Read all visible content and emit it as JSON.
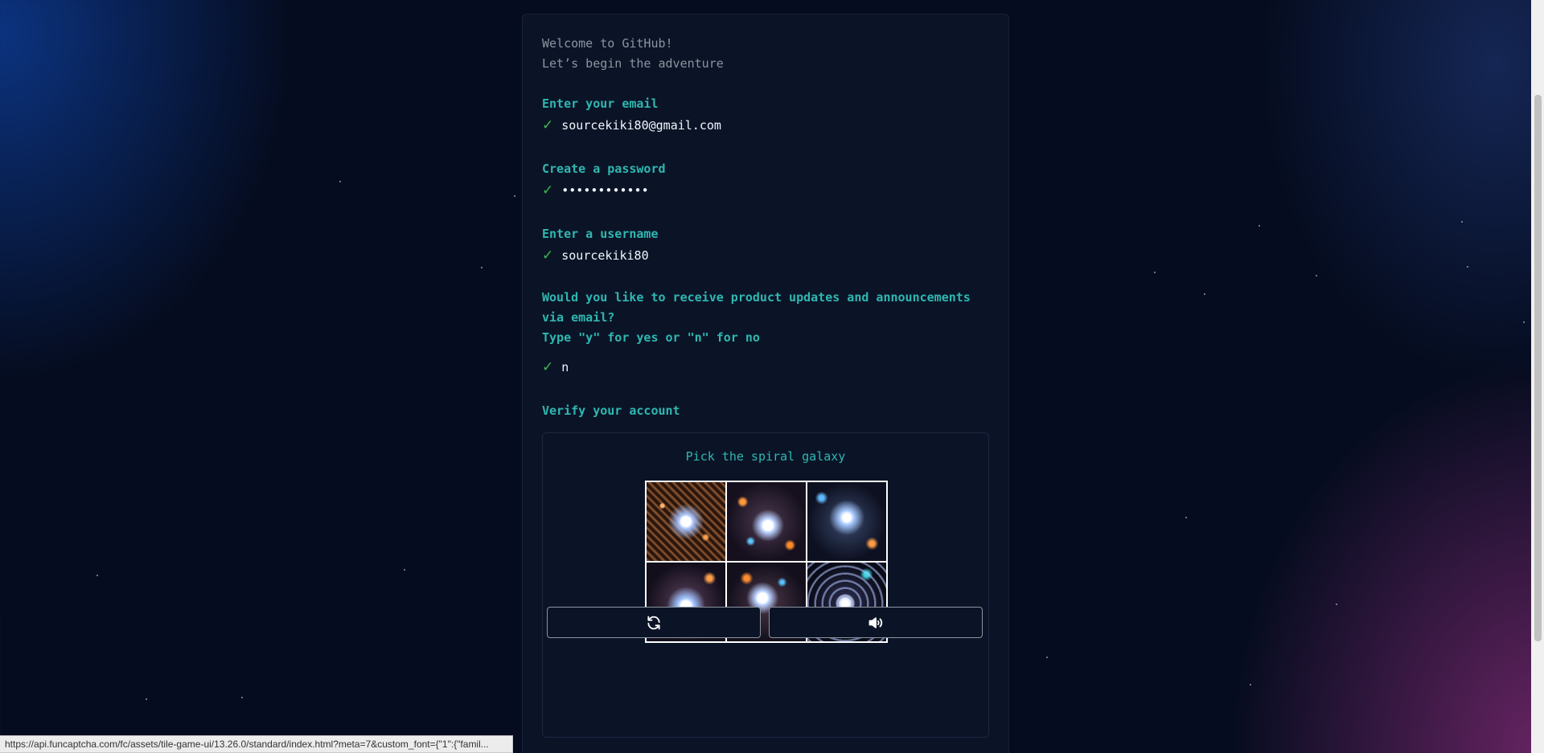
{
  "form": {
    "welcome_line1": "Welcome to GitHub!",
    "welcome_line2": "Let’s begin the adventure",
    "email_label": "Enter your email",
    "email_value": "sourcekiki80@gmail.com",
    "password_label": "Create a password",
    "password_value": "••••••••••••",
    "username_label": "Enter a username",
    "username_value": "sourcekiki80",
    "updates_question": "Would you like to receive product updates and announcements via email?",
    "updates_hint": "Type \"y\" for yes or \"n\" for no",
    "updates_value": "n",
    "verify_label": "Verify your account",
    "check_glyph": "✓"
  },
  "captcha": {
    "prompt": "Pick the spiral galaxy",
    "tiles": [
      "galaxy-tile-1",
      "galaxy-tile-2",
      "galaxy-tile-3",
      "galaxy-tile-4",
      "galaxy-tile-5",
      "galaxy-tile-6"
    ],
    "refresh_icon": "refresh-icon",
    "audio_icon": "speaker-icon"
  },
  "statusbar": {
    "url": "https://api.funcaptcha.com/fc/assets/tile-game-ui/13.26.0/standard/index.html?meta=7&custom_font={\"1\":{\"famil..."
  },
  "colors": {
    "accent": "#2fb7b0",
    "check": "#3fb950",
    "panel": "#0b1427"
  }
}
